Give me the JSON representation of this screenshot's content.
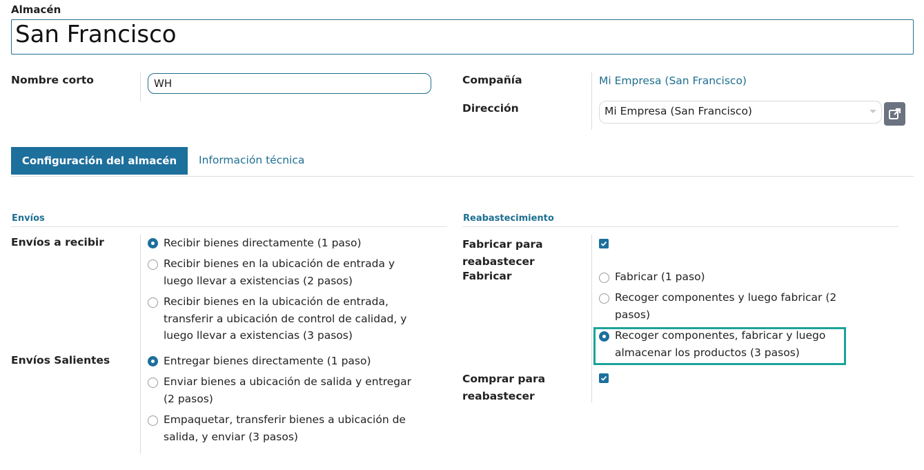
{
  "form": {
    "warehouse_label": "Almacén",
    "warehouse_name": "San Francisco",
    "short_name_label": "Nombre corto",
    "short_name_value": "WH",
    "company_label": "Compañía",
    "company_value": "Mi Empresa (San Francisco)",
    "address_label": "Dirección",
    "address_value": "Mi Empresa (San Francisco)"
  },
  "tabs": [
    {
      "label": "Configuración del almacén",
      "active": true
    },
    {
      "label": "Información técnica",
      "active": false
    }
  ],
  "shipments": {
    "title": "Envíos",
    "incoming_label": "Envíos a recibir",
    "incoming_options": [
      {
        "lines": [
          "Recibir bienes directamente (1 paso)"
        ],
        "selected": true
      },
      {
        "lines": [
          "Recibir bienes en la ubicación de entrada y",
          "luego llevar a existencias (2 pasos)"
        ],
        "selected": false
      },
      {
        "lines": [
          "Recibir bienes en la ubicación de entrada,",
          "transferir a ubicación de control de calidad, y",
          "luego llevar a existencias (3 pasos)"
        ],
        "selected": false
      }
    ],
    "outgoing_label": "Envíos Salientes",
    "outgoing_options": [
      {
        "lines": [
          "Entregar bienes directamente (1 paso)"
        ],
        "selected": true
      },
      {
        "lines": [
          "Enviar bienes a ubicación de salida y entregar",
          "(2 pasos)"
        ],
        "selected": false
      },
      {
        "lines": [
          "Empaquetar, transferir bienes a ubicación de",
          "salida, y enviar (3 pasos)"
        ],
        "selected": false
      }
    ]
  },
  "replenishment": {
    "title": "Reabastecimiento",
    "manufacture_label_lines": [
      "Fabricar para",
      "reabastecer"
    ],
    "manufacture_checked": true,
    "manufacture_steps_label": "Fabricar",
    "manufacture_options": [
      {
        "lines": [
          "Fabricar (1 paso)"
        ],
        "selected": false
      },
      {
        "lines": [
          "Recoger componentes y luego fabricar (2",
          "pasos)"
        ],
        "selected": false
      },
      {
        "lines": [
          "Recoger componentes, fabricar y luego",
          "almacenar los productos (3 pasos)"
        ],
        "selected": true
      }
    ],
    "buy_label_lines": [
      "Comprar para",
      "reabastecer"
    ],
    "buy_checked": true
  },
  "colors": {
    "accent": "#1d6f9c",
    "link": "#1d6f91",
    "highlight": "#1aa39a"
  }
}
